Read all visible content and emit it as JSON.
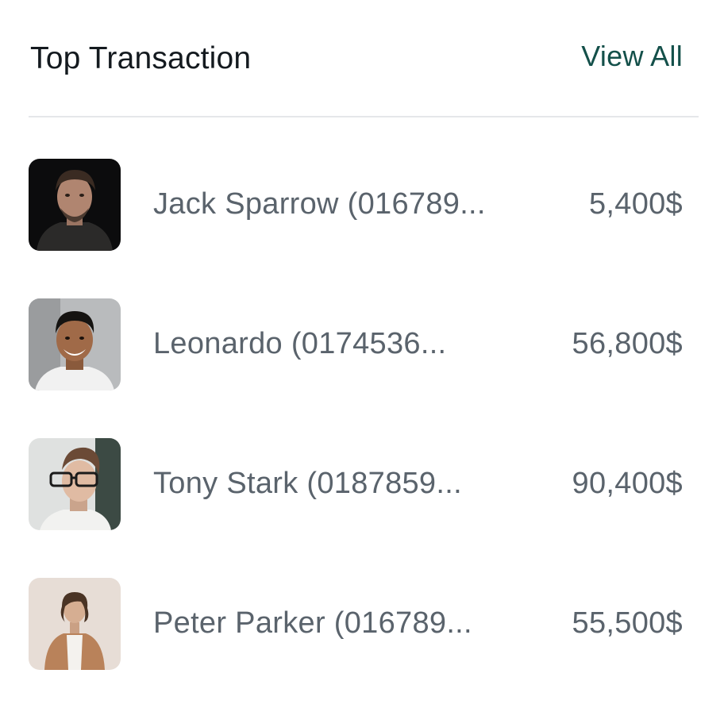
{
  "header": {
    "title": "Top Transaction",
    "view_all_label": "View All"
  },
  "transactions": [
    {
      "name": "Jack Sparrow (016789...",
      "amount": "5,400$",
      "avatar": "portrait-dark-background"
    },
    {
      "name": "Leonardo (0174536...",
      "amount": "56,800$",
      "avatar": "portrait-smiling-man"
    },
    {
      "name": "Tony Stark (0187859...",
      "amount": "90,400$",
      "avatar": "portrait-man-with-glasses"
    },
    {
      "name": "Peter Parker (016789...",
      "amount": "55,500$",
      "avatar": "portrait-man-brown-jacket"
    }
  ],
  "colors": {
    "title": "#141a1f",
    "link": "#14504a",
    "text_secondary": "#5a636c",
    "divider": "#e5e7ea"
  }
}
